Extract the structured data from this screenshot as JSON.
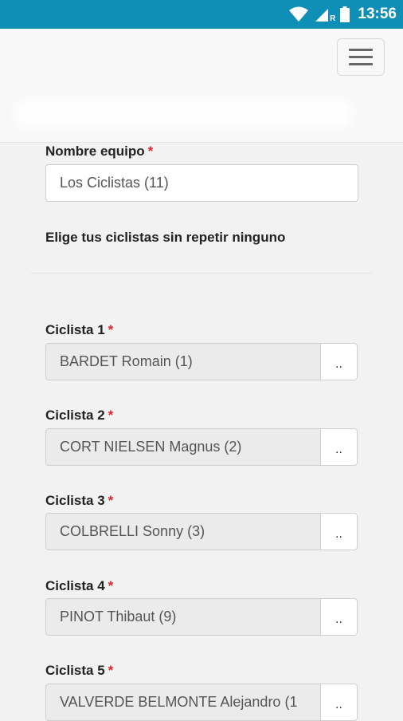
{
  "status_bar": {
    "time": "13:56",
    "network_badge": "R"
  },
  "form": {
    "team_name_label": "Nombre equipo",
    "required_mark": "*",
    "team_name_value": "Los Ciclistas (11)",
    "instruction": "Elige tus ciclistas sin repetir ninguno",
    "picker_button_label": "..",
    "cyclists": [
      {
        "label": "Ciclista 1",
        "value": "BARDET Romain (1)"
      },
      {
        "label": "Ciclista 2",
        "value": "CORT NIELSEN Magnus (2)"
      },
      {
        "label": "Ciclista 3",
        "value": "COLBRELLI Sonny (3)"
      },
      {
        "label": "Ciclista 4",
        "value": "PINOT Thibaut (9)"
      },
      {
        "label": "Ciclista 5",
        "value": "VALVERDE BELMONTE Alejandro (1"
      }
    ]
  }
}
